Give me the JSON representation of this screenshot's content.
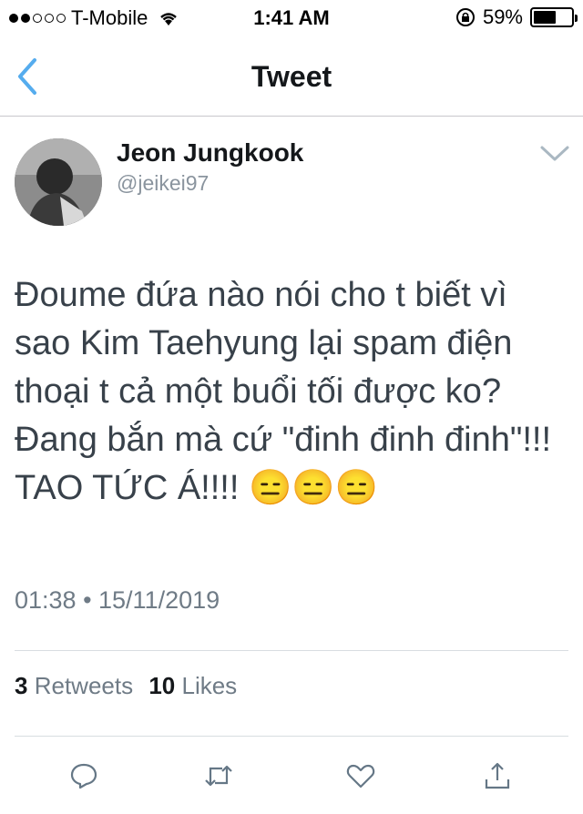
{
  "status_bar": {
    "carrier": "T-Mobile",
    "time": "1:41 AM",
    "battery": "59%",
    "battery_level": 0.59,
    "signal_bars_filled": 2,
    "signal_bars_total": 5
  },
  "nav": {
    "title": "Tweet",
    "back_icon": "chevron-left-icon"
  },
  "tweet": {
    "display_name": "Jeon Jungkook",
    "handle": "@jeikei97",
    "text": "Đoume đứa nào nói cho t biết vì sao Kim Taehyung lại spam điện thoại t cả một buổi tối được ko? Đang bắn mà cứ \"đinh đinh đinh\"!!! TAO TỨC Á!!!! 😑😑😑",
    "timestamp": "01:38 • 15/11/2019",
    "retweets_count": "3",
    "retweets_label": "Retweets",
    "likes_count": "10",
    "likes_label": "Likes"
  },
  "actions": [
    "reply-icon",
    "retweet-icon",
    "like-icon",
    "share-icon"
  ],
  "colors": {
    "accent": "#55acee",
    "text": "#14171a",
    "secondary": "#8a949e"
  }
}
